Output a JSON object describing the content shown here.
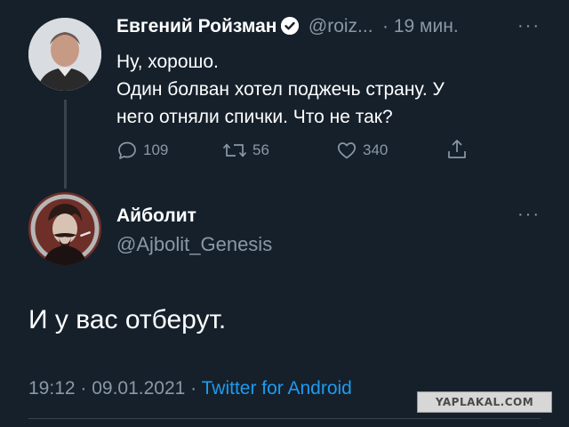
{
  "tweet1": {
    "name": "Евгений Ройзман",
    "handle": "@roiz...",
    "time": "· 19 мин.",
    "more": "···",
    "lines": [
      "Ну, хорошо.",
      "Один болван хотел  поджечь страну. У",
      "него отняли спички. Что не так?"
    ],
    "actions": {
      "reply_count": "109",
      "retweet_count": "56",
      "like_count": "340"
    }
  },
  "tweet2": {
    "name": "Айболит",
    "handle": "@Ajbolit_Genesis",
    "more": "···",
    "text": "И у вас отберут.",
    "footer": {
      "datetime": "19:12 · 09.01.2021 · ",
      "client": "Twitter for Android"
    }
  },
  "watermark": "YAPLAKAL.COM",
  "colors": {
    "background": "#15202b",
    "text": "#ffffff",
    "muted": "#8b98a5",
    "link": "#1d9bf0"
  }
}
